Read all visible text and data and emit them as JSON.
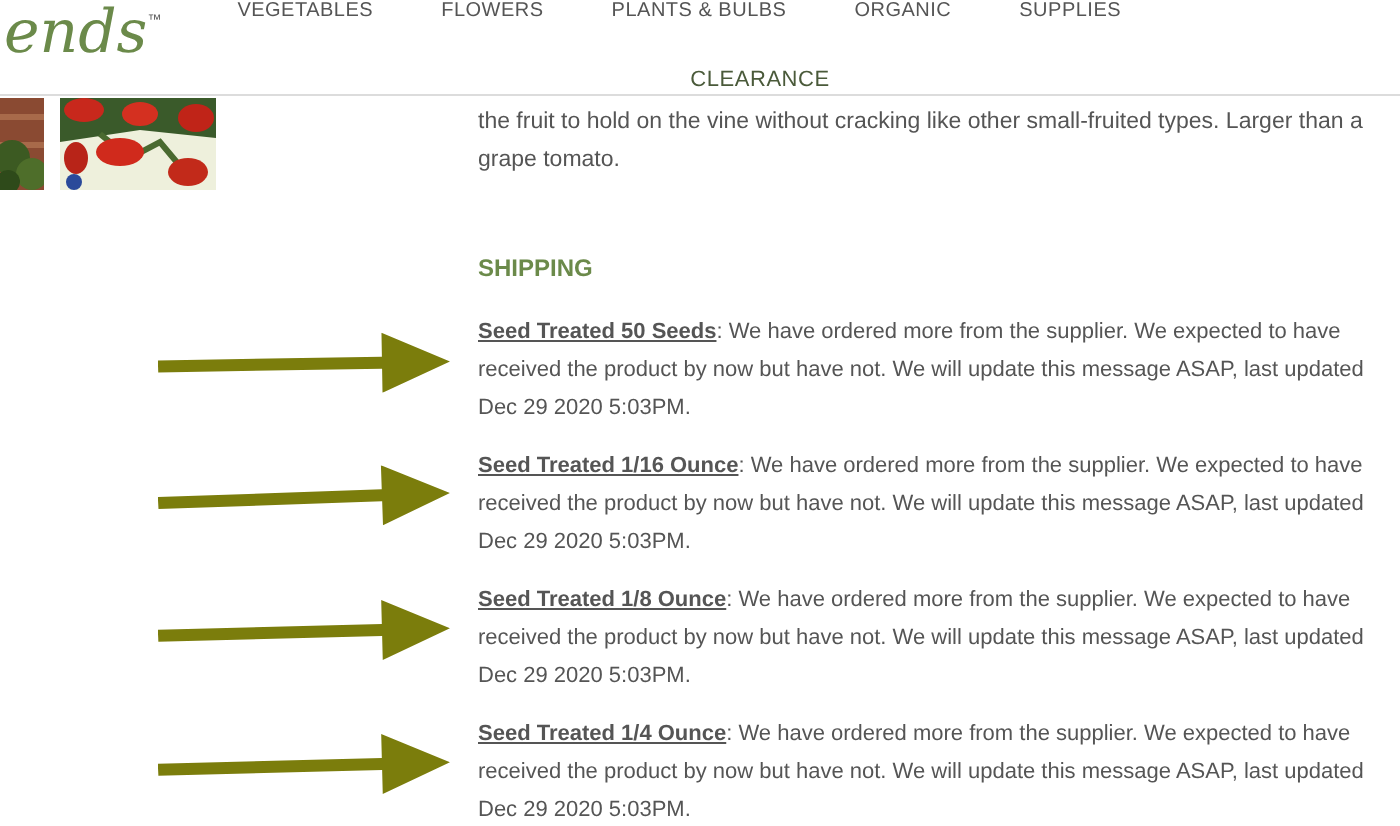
{
  "logo": {
    "text": "ends",
    "mark": "™"
  },
  "nav": {
    "items": [
      "VEGETABLES",
      "FLOWERS",
      "PLANTS & BULBS",
      "ORGANIC",
      "SUPPLIES"
    ],
    "second_row": "CLEARANCE"
  },
  "description": "the fruit to hold on the vine without cracking like other small-fruited types. Larger than a grape tomato.",
  "shipping": {
    "heading": "SHIPPING",
    "notices": [
      {
        "product": "Seed Treated 50 Seeds",
        "message": ": We have ordered more from the supplier. We expected to have received the product by now but have not. We will update this message ASAP, last updated Dec 29 2020 5:03PM."
      },
      {
        "product": "Seed Treated 1/16 Ounce",
        "message": ": We have ordered more from the supplier. We expected to have received the product by now but have not. We will update this message ASAP, last updated Dec 29 2020 5:03PM."
      },
      {
        "product": "Seed Treated 1/8 Ounce",
        "message": ": We have ordered more from the supplier. We expected to have received the product by now but have not. We will update this message ASAP, last updated Dec 29 2020 5:03PM."
      },
      {
        "product": "Seed Treated 1/4 Ounce",
        "message": ": We have ordered more from the supplier. We expected to have received the product by now but have not. We will update this message ASAP, last updated Dec 29 2020 5:03PM."
      }
    ]
  }
}
